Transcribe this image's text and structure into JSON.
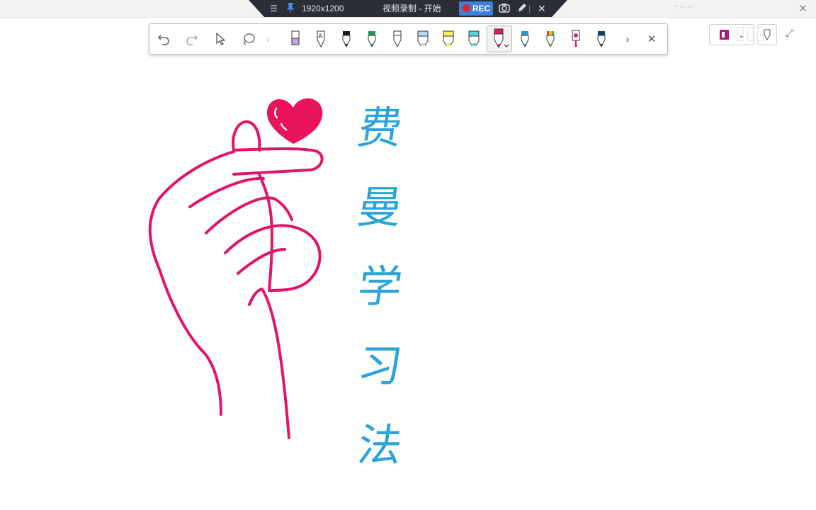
{
  "recorder": {
    "resolution": "1920x1200",
    "title": "视频录制 - 开始",
    "rec_label": "REC"
  },
  "toolbar": {
    "tools": [
      "undo-icon",
      "redo-icon",
      "select-icon",
      "lasso-icon"
    ],
    "pens": [
      {
        "name": "pen-lavender",
        "color": "#c9a3e0"
      },
      {
        "name": "pen-text-A",
        "color": "#ffffff"
      },
      {
        "name": "pen-black",
        "color": "#1b1b1b"
      },
      {
        "name": "pen-green",
        "color": "#1f9a4a"
      },
      {
        "name": "pen-white",
        "color": "#ffffff"
      },
      {
        "name": "highlighter-lightblue",
        "color": "#b9d8f5"
      },
      {
        "name": "highlighter-yellow",
        "color": "#f7f060"
      },
      {
        "name": "highlighter-cyan",
        "color": "#52d6e6"
      },
      {
        "name": "pen-pink-selected",
        "color": "#e0156a"
      },
      {
        "name": "pen-blue",
        "color": "#1f9bd6"
      },
      {
        "name": "pen-rainbow",
        "color": "#e6a020"
      },
      {
        "name": "pen-magenta-stamp",
        "color": "#c0288a"
      },
      {
        "name": "pen-navy",
        "color": "#123a6b"
      }
    ]
  },
  "drawing": {
    "heart_color": "#e8135b",
    "hand_color": "#e0156a",
    "text_color": "#2aa4d9",
    "chars": [
      "费",
      "曼",
      "学",
      "习",
      "法"
    ]
  }
}
